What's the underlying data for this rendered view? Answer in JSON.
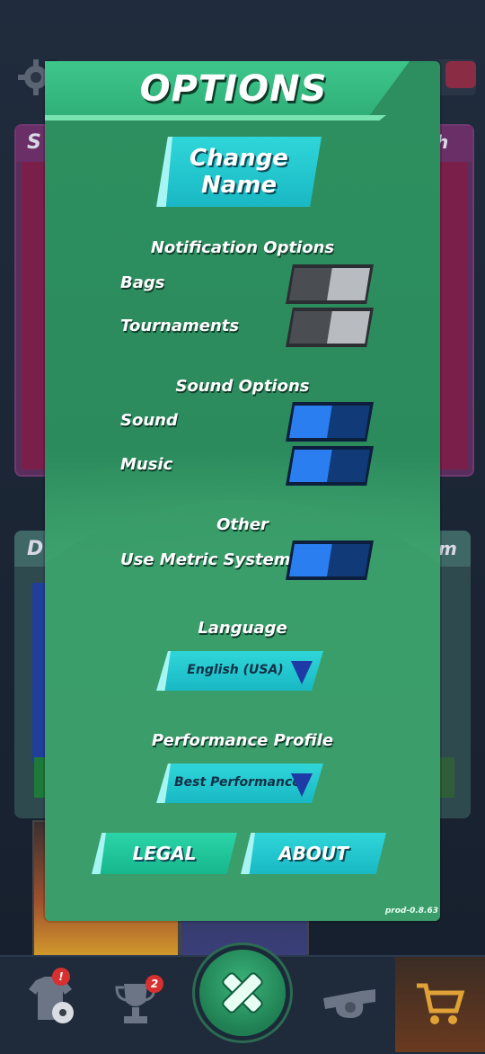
{
  "background": {
    "card1_title_start": "S",
    "card1_title_end": "h",
    "card2_title_start": "D",
    "card2_title_end": "m",
    "nav": {
      "jersey_badge": "!",
      "trophy_badge": "2"
    }
  },
  "panel": {
    "title": "OPTIONS",
    "change_name_label": "Change\nName",
    "notification_heading": "Notification Options",
    "notifications": [
      {
        "label": "Bags",
        "enabled": false
      },
      {
        "label": "Tournaments",
        "enabled": false
      }
    ],
    "sound_heading": "Sound Options",
    "sound": [
      {
        "label": "Sound",
        "enabled": true
      },
      {
        "label": "Music",
        "enabled": true
      }
    ],
    "other_heading": "Other",
    "other": [
      {
        "label": "Use Metric System",
        "enabled": true
      }
    ],
    "language_heading": "Language",
    "language_value": "English (USA)",
    "performance_heading": "Performance Profile",
    "performance_value": "Best Performance",
    "legal_label": "LEGAL",
    "about_label": "ABOUT",
    "version": "prod-0.8.63"
  },
  "colors": {
    "panel_green": "#2d8f5f",
    "toggle_on": "#2a7ef0",
    "toggle_off": "#b8bcc0",
    "button_cyan": "#2fd6d9"
  }
}
